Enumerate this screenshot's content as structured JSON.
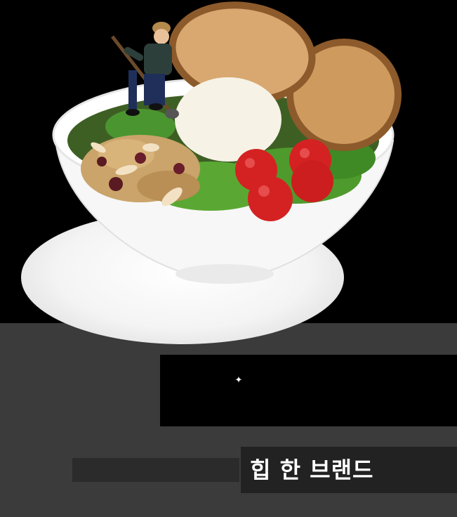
{
  "tagline": {
    "text": "힙 한 브랜드"
  },
  "logo": {
    "sparkle_glyph": "✦"
  },
  "colors": {
    "background": "#000000",
    "band": "#3b3b3b",
    "bowl": "#ffffff",
    "tomato": "#d42222",
    "lettuce": "#4f9a2c",
    "bread": "#c9884a"
  }
}
